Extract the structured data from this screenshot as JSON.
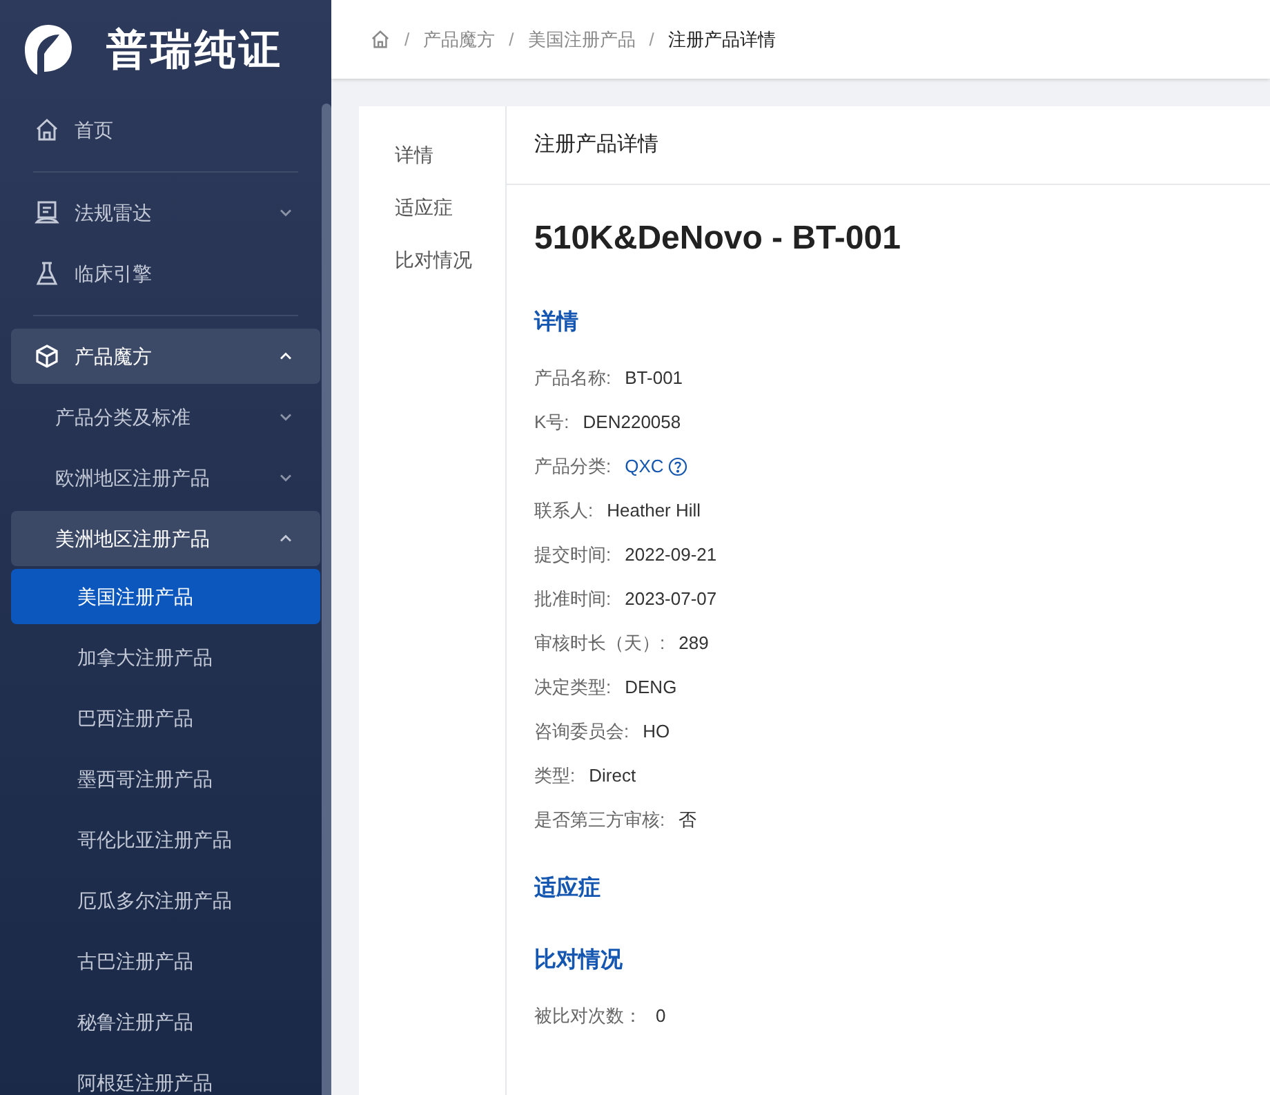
{
  "logo": {
    "text": "普瑞纯证"
  },
  "sidebar": {
    "items": [
      {
        "kind": "item",
        "label": "首页"
      },
      {
        "kind": "divider"
      },
      {
        "kind": "item",
        "label": "法规雷达",
        "expanded": false
      },
      {
        "kind": "item",
        "label": "临床引擎"
      },
      {
        "kind": "divider"
      },
      {
        "kind": "item",
        "label": "产品魔方",
        "expanded": true,
        "children": [
          {
            "label": "产品分类及标准",
            "expanded": false
          },
          {
            "label": "欧洲地区注册产品",
            "expanded": false
          },
          {
            "label": "美洲地区注册产品",
            "expanded": true,
            "children": [
              {
                "label": "美国注册产品",
                "selected": true
              },
              {
                "label": "加拿大注册产品",
                "selected": false
              },
              {
                "label": "巴西注册产品",
                "selected": false
              },
              {
                "label": "墨西哥注册产品",
                "selected": false
              },
              {
                "label": "哥伦比亚注册产品",
                "selected": false
              },
              {
                "label": "厄瓜多尔注册产品",
                "selected": false
              },
              {
                "label": "古巴注册产品",
                "selected": false
              },
              {
                "label": "秘鲁注册产品",
                "selected": false
              },
              {
                "label": "阿根廷注册产品",
                "selected": false
              }
            ]
          }
        ]
      }
    ]
  },
  "breadcrumb": {
    "separator": "/",
    "items": [
      "产品魔方",
      "美国注册产品",
      "注册产品详情"
    ]
  },
  "anchor_nav": [
    "详情",
    "适应症",
    "比对情况"
  ],
  "panel_title": "注册产品详情",
  "product_title": "510K&DeNovo - BT-001",
  "sections": [
    {
      "heading": "详情",
      "fields": [
        {
          "label": "产品名称:",
          "value": "BT-001",
          "kind": "text"
        },
        {
          "label": "K号:",
          "value": "DEN220058",
          "kind": "text"
        },
        {
          "label": "产品分类:",
          "value": "QXC",
          "kind": "link"
        },
        {
          "label": "联系人:",
          "value": "Heather Hill",
          "kind": "text"
        },
        {
          "label": "提交时间:",
          "value": "2022-09-21",
          "kind": "text"
        },
        {
          "label": "批准时间:",
          "value": "2023-07-07",
          "kind": "text"
        },
        {
          "label": "审核时长（天）:",
          "value": "289",
          "kind": "text"
        },
        {
          "label": "决定类型:",
          "value": "DENG",
          "kind": "text"
        },
        {
          "label": "咨询委员会:",
          "value": "HO",
          "kind": "text"
        },
        {
          "label": "类型:",
          "value": "Direct",
          "kind": "text"
        },
        {
          "label": "是否第三方审核:",
          "value": "否",
          "kind": "text"
        }
      ]
    },
    {
      "heading": "适应症"
    },
    {
      "heading": "比对情况",
      "fields": [
        {
          "label": "被比对次数：",
          "value": "0",
          "kind": "text"
        }
      ]
    }
  ]
}
